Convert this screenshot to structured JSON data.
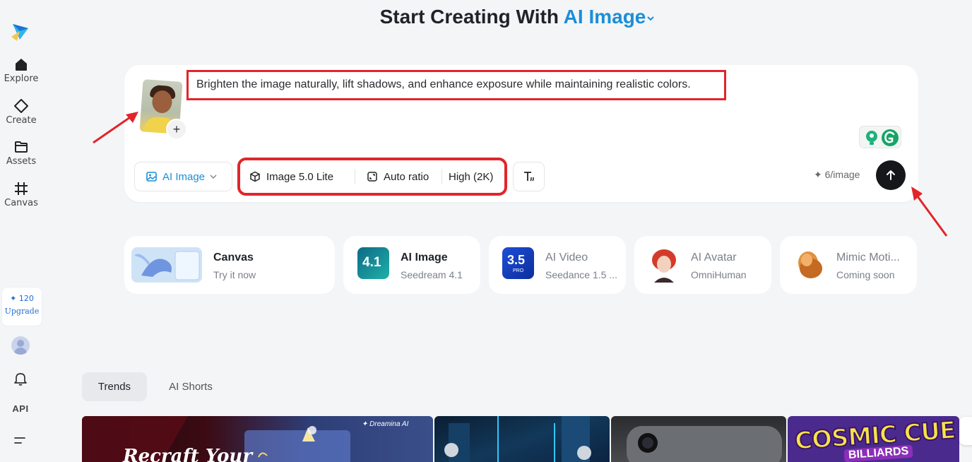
{
  "header": {
    "title_prefix": "Start Creating With",
    "title_accent": "AI Image"
  },
  "sidebar": {
    "items": [
      {
        "label": "Explore",
        "icon": "home-icon"
      },
      {
        "label": "Create",
        "icon": "diamond-icon"
      },
      {
        "label": "Assets",
        "icon": "folder-icon"
      },
      {
        "label": "Canvas",
        "icon": "canvas-icon"
      }
    ],
    "credits": "✦ 120",
    "upgrade_label": "Upgrade",
    "api_label": "API"
  },
  "prompt": {
    "text": "Brighten the image naturally, lift shadows, and enhance exposure while maintaining realistic colors.",
    "add_label": "+"
  },
  "toolbar": {
    "mode_label": "AI Image",
    "model_label": "Image 5.0 Lite",
    "ratio_label": "Auto ratio",
    "quality_label": "High (2K)",
    "cost_label": "✦ 6/image"
  },
  "features": [
    {
      "name": "Canvas",
      "sub": "Try it now"
    },
    {
      "name": "AI Image",
      "sub": "Seedream 4.1",
      "badge": "4.1"
    },
    {
      "name": "AI Video",
      "sub": "Seedance 1.5 ...",
      "badge": "3.5",
      "badge_sub": "PRO"
    },
    {
      "name": "AI Avatar",
      "sub": "OmniHuman"
    },
    {
      "name": "Mimic Moti...",
      "sub": "Coming soon"
    }
  ],
  "tabs": [
    {
      "label": "Trends",
      "active": true
    },
    {
      "label": "AI Shorts",
      "active": false
    }
  ],
  "gallery": {
    "item1_text": "Recraft Your",
    "item1_brand": "✦ Dreamina AI",
    "item4_title": "COSMIC CUE",
    "item4_sub": "BILLIARDS"
  },
  "colors": {
    "accent": "#1a8fd8",
    "annotation_red": "#e1252b",
    "send_button": "#15171a"
  }
}
